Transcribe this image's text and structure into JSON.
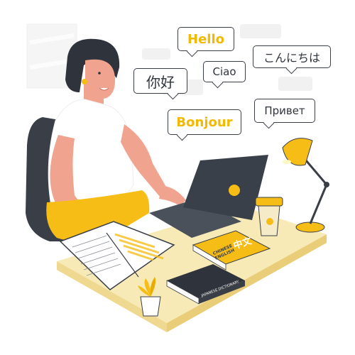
{
  "bubbles": {
    "hello": "Hello",
    "konnichiwa": "こんにちは",
    "nihao": "你好",
    "ciao": "Ciao",
    "bonjour": "Bonjour",
    "privet": "Привет"
  },
  "book_cover": {
    "chinese_title": "中文",
    "english_title": "CHINESE ENGLISH"
  },
  "dictionary_spine": "JAPANESE DICTIONARY",
  "colors": {
    "accent": "#f7bd17",
    "dark": "#3a3f47",
    "skin": "#f0a48f",
    "desk": "#f8eab6",
    "laptop": "#394049"
  }
}
